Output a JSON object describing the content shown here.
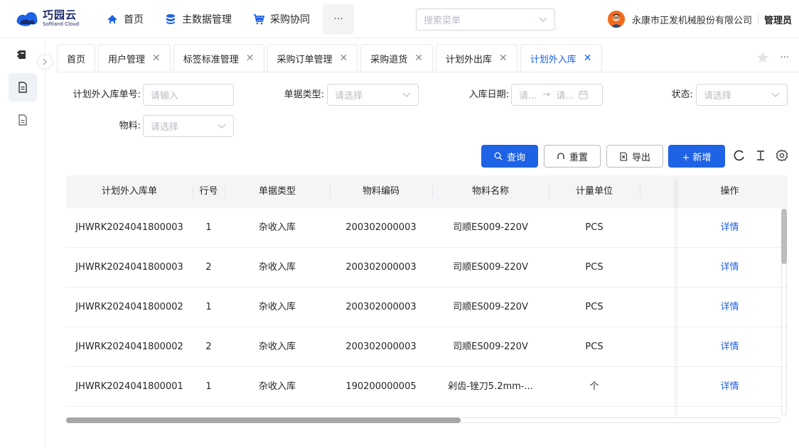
{
  "brand": {
    "name_cn": "巧园云",
    "name_en": "Softland Cloud"
  },
  "nav": {
    "items": [
      {
        "label": "首页",
        "icon": "home-icon"
      },
      {
        "label": "主数据管理",
        "icon": "database-icon"
      },
      {
        "label": "采购协同",
        "icon": "cart-icon"
      }
    ],
    "more": "···"
  },
  "menu_search": {
    "placeholder": "搜索菜单"
  },
  "user": {
    "company": "永康市正发机械股份有限公司",
    "role": "管理员"
  },
  "tabs": [
    {
      "label": "首页",
      "closable": false,
      "active": false
    },
    {
      "label": "用户管理",
      "closable": true,
      "active": false
    },
    {
      "label": "标签标准管理",
      "closable": true,
      "active": false
    },
    {
      "label": "采购订单管理",
      "closable": true,
      "active": false
    },
    {
      "label": "采购退货",
      "closable": true,
      "active": false
    },
    {
      "label": "计划外出库",
      "closable": true,
      "active": false
    },
    {
      "label": "计划外入库",
      "closable": true,
      "active": true
    }
  ],
  "close_glyph": "✕",
  "tab_more": "···",
  "filters": {
    "order_no": {
      "label": "计划外入库单号:",
      "placeholder": "请输入"
    },
    "doc_type": {
      "label": "单据类型:",
      "placeholder": "请选择"
    },
    "date": {
      "label": "入库日期:",
      "start": "请...",
      "arrow": "→",
      "end": "请..."
    },
    "status": {
      "label": "状态:",
      "placeholder": "请选择"
    },
    "material": {
      "label": "物料:",
      "placeholder": "请选择"
    }
  },
  "actions": {
    "query": "查询",
    "reset": "重置",
    "export": "导出",
    "add": "+ 新增"
  },
  "table": {
    "columns": [
      "计划外入库单",
      "行号",
      "单据类型",
      "物料编码",
      "物料名称",
      "计量单位",
      "操作"
    ],
    "rows": [
      {
        "doc": "JHWRK2024041800003",
        "line": "1",
        "type": "杂收入库",
        "code": "200302000003",
        "name": "司顺ES009-220V",
        "unit": "PCS",
        "op": "详情"
      },
      {
        "doc": "JHWRK2024041800003",
        "line": "2",
        "type": "杂收入库",
        "code": "200302000003",
        "name": "司顺ES009-220V",
        "unit": "PCS",
        "op": "详情"
      },
      {
        "doc": "JHWRK2024041800002",
        "line": "1",
        "type": "杂收入库",
        "code": "200302000003",
        "name": "司顺ES009-220V",
        "unit": "PCS",
        "op": "详情"
      },
      {
        "doc": "JHWRK2024041800002",
        "line": "2",
        "type": "杂收入库",
        "code": "200302000003",
        "name": "司顺ES009-220V",
        "unit": "PCS",
        "op": "详情"
      },
      {
        "doc": "JHWRK2024041800001",
        "line": "1",
        "type": "杂收入库",
        "code": "190200000005",
        "name": "剁齿-锉刀5.2mm-...",
        "unit": "个",
        "op": "详情"
      }
    ]
  },
  "colors": {
    "primary": "#1e62e6",
    "border": "#d4d7de",
    "header_bg": "#f4f5f7"
  }
}
